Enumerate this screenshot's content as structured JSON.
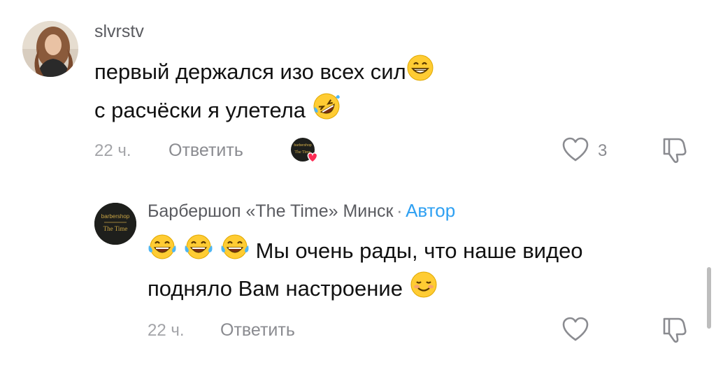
{
  "comment": {
    "username": "slvrstv",
    "text_line1": "первый держался изо всех сил",
    "text_line2": "с расчёски я улетела",
    "time": "22 ч.",
    "reply_label": "Ответить",
    "like_count": "3",
    "line1_emoji": "grinning-face-icon",
    "line2_emoji": "rolling-on-the-floor-laughing-icon"
  },
  "reply": {
    "username": "Барбершоп «The Time» Минск",
    "separator": "·",
    "author_label": "Автор",
    "text_line1": "Мы очень рады, что наше видео",
    "text_line2": "подняло Вам настроение",
    "time": "22 ч.",
    "reply_label": "Ответить",
    "avatar_text_top": "barbershop",
    "avatar_text_bottom": "The Time",
    "leading_emoji": "face-with-tears-of-joy-icon",
    "trailing_emoji": "smiling-face-icon"
  },
  "colors": {
    "author_tag": "#2ea0f2",
    "creator_liked_heart": "#fe2c55"
  }
}
